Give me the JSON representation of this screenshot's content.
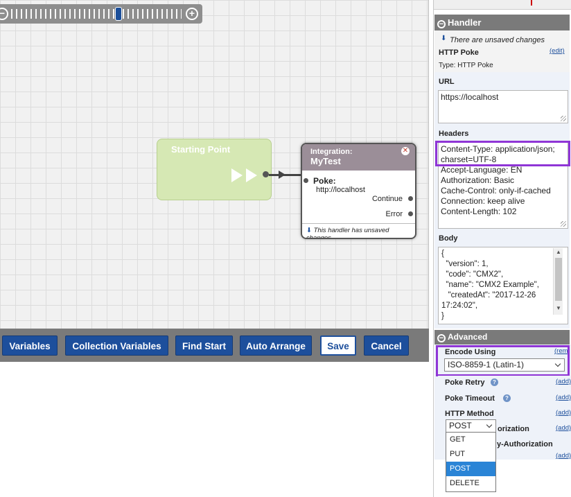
{
  "canvas": {
    "start_node": {
      "title": "Starting Point"
    },
    "integration_node": {
      "kicker": "Integration:",
      "title": "MyTest",
      "poke_label": "Poke:",
      "poke_url": "http://localhost",
      "continue_label": "Continue",
      "error_label": "Error",
      "footer_note": "This handler has unsaved changes"
    }
  },
  "toolbar": {
    "variables": "Variables",
    "collection_variables": "Collection Variables",
    "find_start": "Find Start",
    "auto_arrange": "Auto Arrange",
    "save": "Save",
    "cancel": "Cancel"
  },
  "panel": {
    "handler_header": "Handler",
    "unsaved_note": "There are unsaved changes",
    "handler_name": "HTTP Poke",
    "handler_type": "Type: HTTP Poke",
    "edit_link": "(edit)",
    "url_label": "URL",
    "url_value": "https://localhost",
    "headers_label": "Headers",
    "headers_lines": {
      "l1": "Content-Type: application/json;",
      "l2": "charset=UTF-8",
      "l3": "Accept-Language: EN",
      "l4": "Authorization: Basic",
      "l5": "Cache-Control: only-if-cached",
      "l6": "Connection: keep alive",
      "l7": "Content-Length: 102"
    },
    "body_label": "Body",
    "body_lines": {
      "l1": "{",
      "l2": "  \"version\": 1,",
      "l3": "  \"code\": \"CMX2\",",
      "l4": "  \"name\": \"CMX2 Example\",",
      "l5": "   \"createdAt\": \"2017-12-26",
      "l6": "17:24:02\",",
      "l7": "}"
    },
    "advanced_header": "Advanced",
    "encode_label": "Encode Using",
    "encode_value": "ISO-8859-1 (Latin-1)",
    "remove_link": "(rem",
    "poke_retry_label": "Poke Retry",
    "poke_timeout_label": "Poke Timeout",
    "http_method_label": "HTTP Method",
    "add_link": "(add)",
    "row_partial_1": "orization",
    "row_partial_2": "y-Authorization",
    "method_value": "POST",
    "method_options": {
      "o1": "GET",
      "o2": "PUT",
      "o3": "POST",
      "o4": "DELETE"
    }
  }
}
